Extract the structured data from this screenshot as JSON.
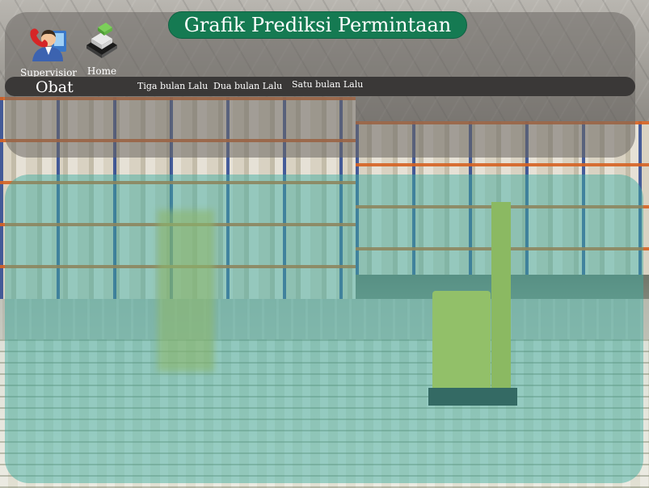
{
  "header": {
    "title": "Grafik Prediksi Permintaan"
  },
  "toolbar": {
    "supervisor_label": "Supervisior",
    "home_label": "Home"
  },
  "nav": {
    "category_label": "Obat",
    "links": [
      "Tiga bulan Lalu",
      "Dua bulan Lalu",
      "Satu bulan Lalu"
    ]
  },
  "colors": {
    "title_bg": "#157a52",
    "nav_bg": "#3a3837",
    "panel_tint": "#3dada1"
  }
}
